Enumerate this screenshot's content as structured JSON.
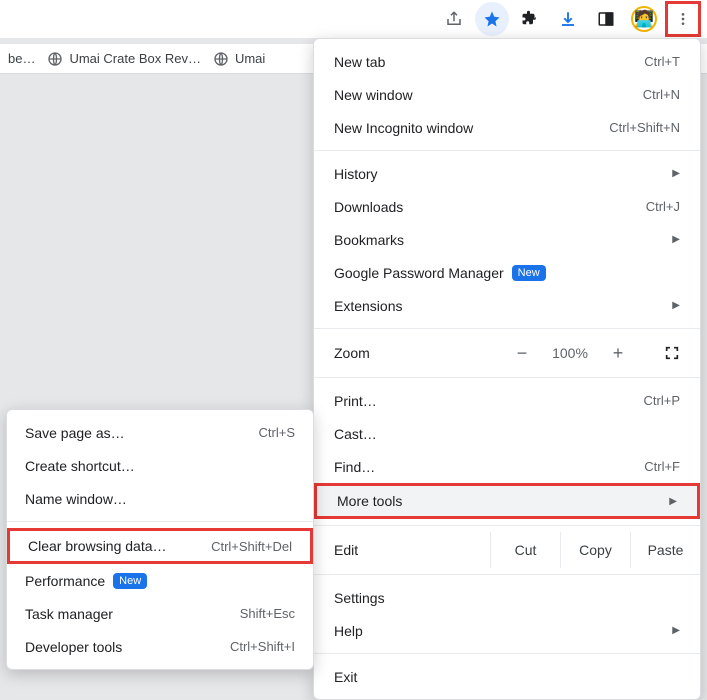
{
  "bookmarks": [
    {
      "label": "be…"
    },
    {
      "label": "Umai Crate Box Rev…"
    },
    {
      "label": "Umai"
    }
  ],
  "menu": {
    "new_tab": {
      "label": "New tab",
      "shortcut": "Ctrl+T"
    },
    "new_window": {
      "label": "New window",
      "shortcut": "Ctrl+N"
    },
    "new_incognito": {
      "label": "New Incognito window",
      "shortcut": "Ctrl+Shift+N"
    },
    "history": {
      "label": "History"
    },
    "downloads": {
      "label": "Downloads",
      "shortcut": "Ctrl+J"
    },
    "bookmarks": {
      "label": "Bookmarks"
    },
    "password_mgr": {
      "label": "Google Password Manager",
      "badge": "New"
    },
    "extensions": {
      "label": "Extensions"
    },
    "zoom": {
      "label": "Zoom",
      "minus": "−",
      "value": "100%",
      "plus": "+"
    },
    "print": {
      "label": "Print…",
      "shortcut": "Ctrl+P"
    },
    "cast": {
      "label": "Cast…"
    },
    "find": {
      "label": "Find…",
      "shortcut": "Ctrl+F"
    },
    "more_tools": {
      "label": "More tools"
    },
    "edit": {
      "label": "Edit",
      "cut": "Cut",
      "copy": "Copy",
      "paste": "Paste"
    },
    "settings": {
      "label": "Settings"
    },
    "help": {
      "label": "Help"
    },
    "exit": {
      "label": "Exit"
    }
  },
  "submenu": {
    "save_page": {
      "label": "Save page as…",
      "shortcut": "Ctrl+S"
    },
    "create_shortcut": {
      "label": "Create shortcut…"
    },
    "name_window": {
      "label": "Name window…"
    },
    "clear_data": {
      "label": "Clear browsing data…",
      "shortcut": "Ctrl+Shift+Del"
    },
    "performance": {
      "label": "Performance",
      "badge": "New"
    },
    "task_manager": {
      "label": "Task manager",
      "shortcut": "Shift+Esc"
    },
    "dev_tools": {
      "label": "Developer tools",
      "shortcut": "Ctrl+Shift+I"
    }
  }
}
